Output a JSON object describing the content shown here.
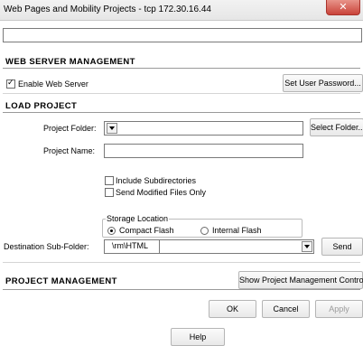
{
  "window": {
    "title": "Web Pages and Mobility Projects - tcp 172.30.16.44"
  },
  "web_server": {
    "heading": "WEB SERVER MANAGEMENT",
    "enable_label": "Enable Web Server",
    "enable_checked": true,
    "set_password_button": "Set User Password..."
  },
  "load_project": {
    "heading": "LOAD PROJECT",
    "project_folder_label": "Project Folder:",
    "select_folder_button": "Select Folder...",
    "project_name_label": "Project Name:",
    "project_name_value": "",
    "include_subdirectories_label": "Include Subdirectories",
    "send_modified_label": "Send Modified Files Only",
    "storage": {
      "legend": "Storage Location",
      "compact_flash_label": "Compact Flash",
      "internal_flash_label": "Internal Flash",
      "selected": "Compact Flash"
    },
    "destination_label": "Destination Sub-Folder:",
    "destination_prefix": "\\rm\\HTML",
    "destination_value": "",
    "send_button": "Send"
  },
  "project_management": {
    "heading": "PROJECT MANAGEMENT",
    "show_controls_button": "Show Project Management Controls"
  },
  "footer": {
    "ok_button": "OK",
    "cancel_button": "Cancel",
    "apply_button": "Apply",
    "help_button": "Help"
  },
  "icons": {
    "close": "close-icon",
    "checkmark": "checkmark-icon",
    "dropdown": "chevron-down-icon"
  }
}
